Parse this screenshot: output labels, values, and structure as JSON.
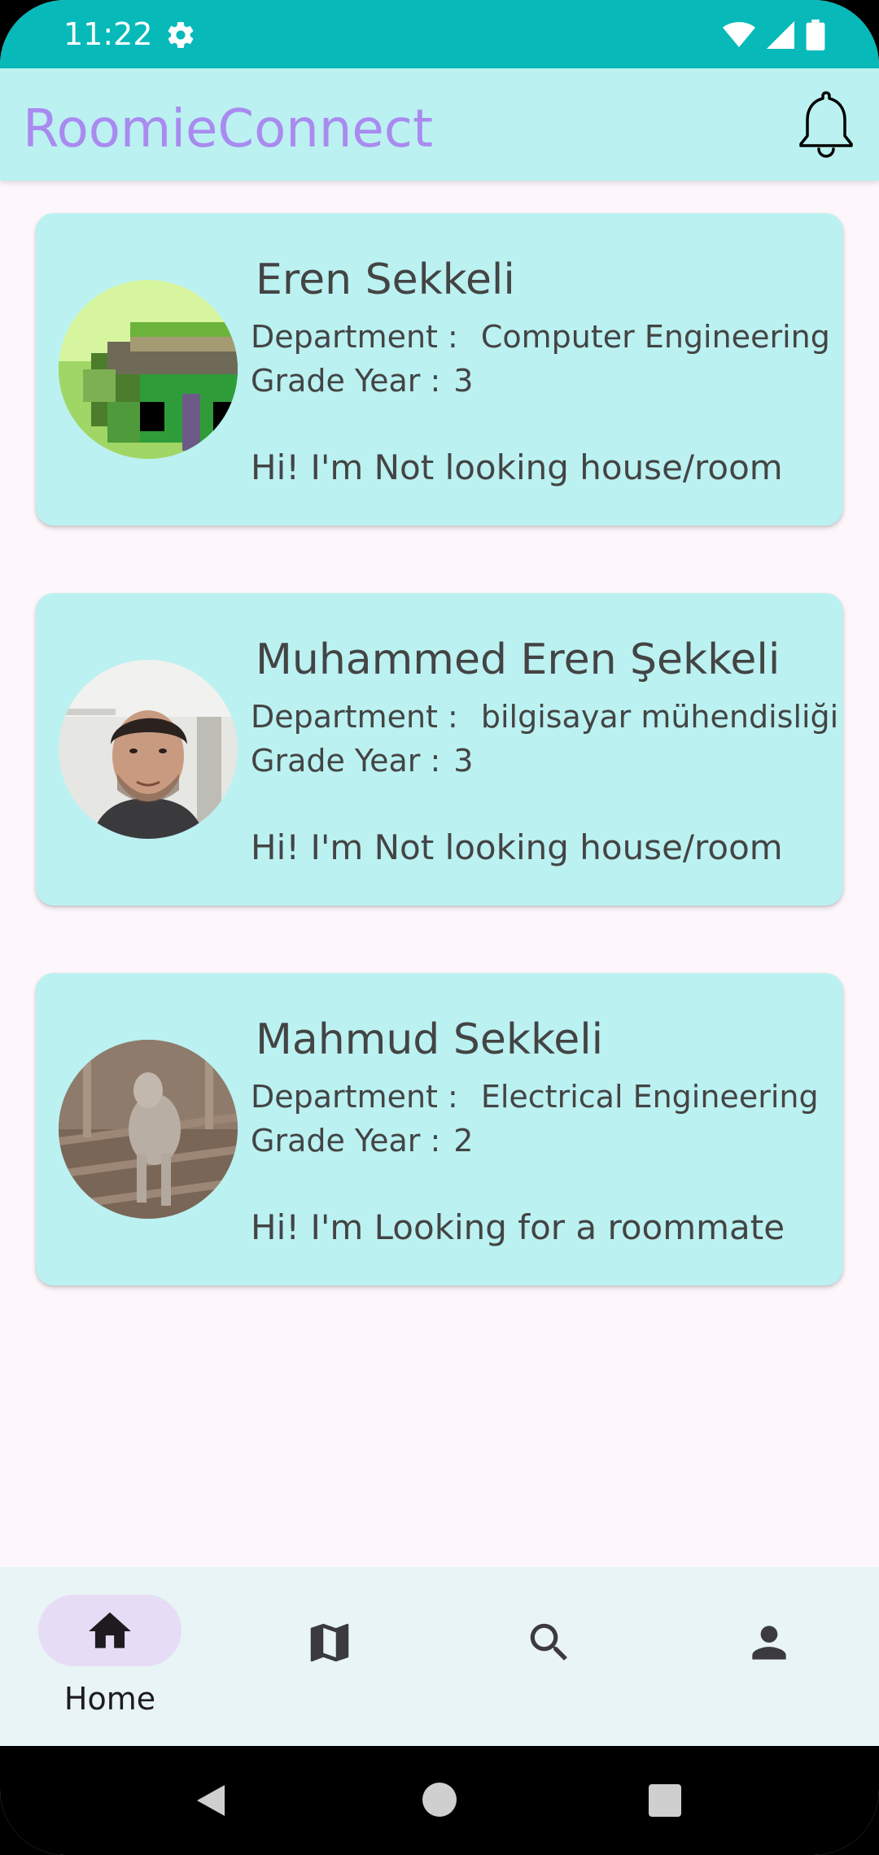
{
  "status_bar": {
    "time": "11:22"
  },
  "app_bar": {
    "title": "RoomieConnect"
  },
  "cards": [
    {
      "name": "Eren Sekkeli",
      "department_label": "Department :",
      "department": "Computer Engineering",
      "grade_label": "Grade Year :",
      "grade": "3",
      "bio": "Hi! I'm Not looking house/room",
      "avatar": "pixel-art-avatar"
    },
    {
      "name": "Muhammed Eren Şekkeli",
      "department_label": "Department :",
      "department": "bilgisayar mühendisliği",
      "grade_label": "Grade Year :",
      "grade": "3",
      "bio": "Hi! I'm Not looking house/room",
      "avatar": "selfie-photo-avatar"
    },
    {
      "name": "Mahmud Sekkeli",
      "department_label": "Department :",
      "department": "Electrical Engineering",
      "grade_label": "Grade Year :",
      "grade": "2",
      "bio": "Hi! I'm Looking for a roommate",
      "avatar": "dog-photo-avatar"
    }
  ],
  "bottom_nav": {
    "items": [
      {
        "icon": "home-icon",
        "label": "Home",
        "selected": true
      },
      {
        "icon": "map-icon",
        "label": "",
        "selected": false
      },
      {
        "icon": "search-icon",
        "label": "",
        "selected": false
      },
      {
        "icon": "person-icon",
        "label": "",
        "selected": false
      }
    ]
  },
  "colors": {
    "status_bar": "#07b9b9",
    "app_bar": "#bbf1f1",
    "title": "#a98bf0",
    "card": "#bbf1f1",
    "background": "#fdf7fb",
    "nav_bar": "#e8f4f5",
    "nav_pill": "#e7dcf5"
  }
}
